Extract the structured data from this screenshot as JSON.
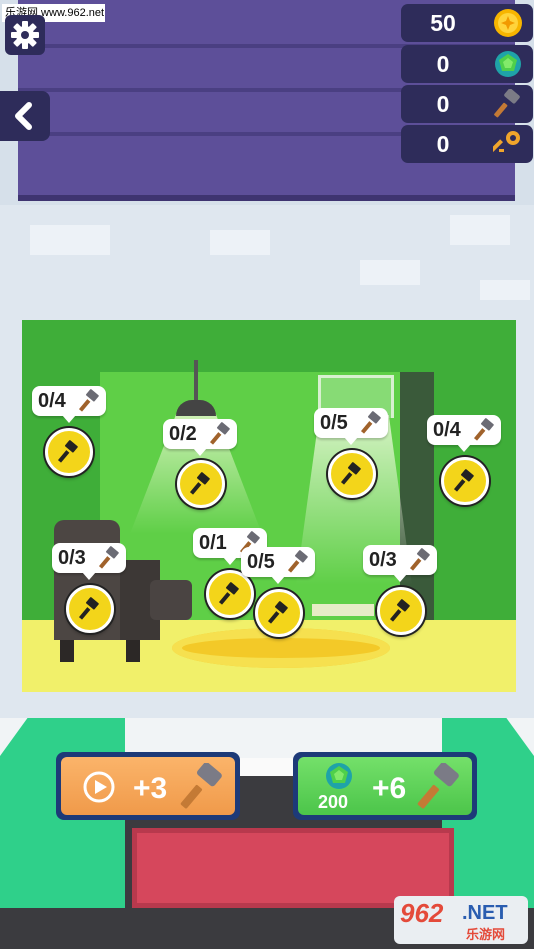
{
  "watermark": "乐游网 www.962.net",
  "stats": [
    {
      "name": "coins",
      "value": "50",
      "icon": "coin-icon"
    },
    {
      "name": "gems",
      "value": "0",
      "icon": "gem-icon"
    },
    {
      "name": "hammers",
      "value": "0",
      "icon": "hammer-icon"
    },
    {
      "name": "keys",
      "value": "0",
      "icon": "key-icon"
    }
  ],
  "hotspots": [
    {
      "label": "0/4"
    },
    {
      "label": "0/2"
    },
    {
      "label": "0/5"
    },
    {
      "label": "0/4"
    },
    {
      "label": "0/3"
    },
    {
      "label": "0/1"
    },
    {
      "label": "0/5"
    },
    {
      "label": "0/3"
    }
  ],
  "actions": {
    "video_reward": "+3",
    "gem_reward": "+6",
    "gem_cost": "200"
  },
  "logo": {
    "big": "962",
    "net": ".NET",
    "cn": "乐游网"
  },
  "colors": {
    "coin": "#f3d51a",
    "room_green": "#3fae39",
    "panel": "#2e2c5a"
  }
}
